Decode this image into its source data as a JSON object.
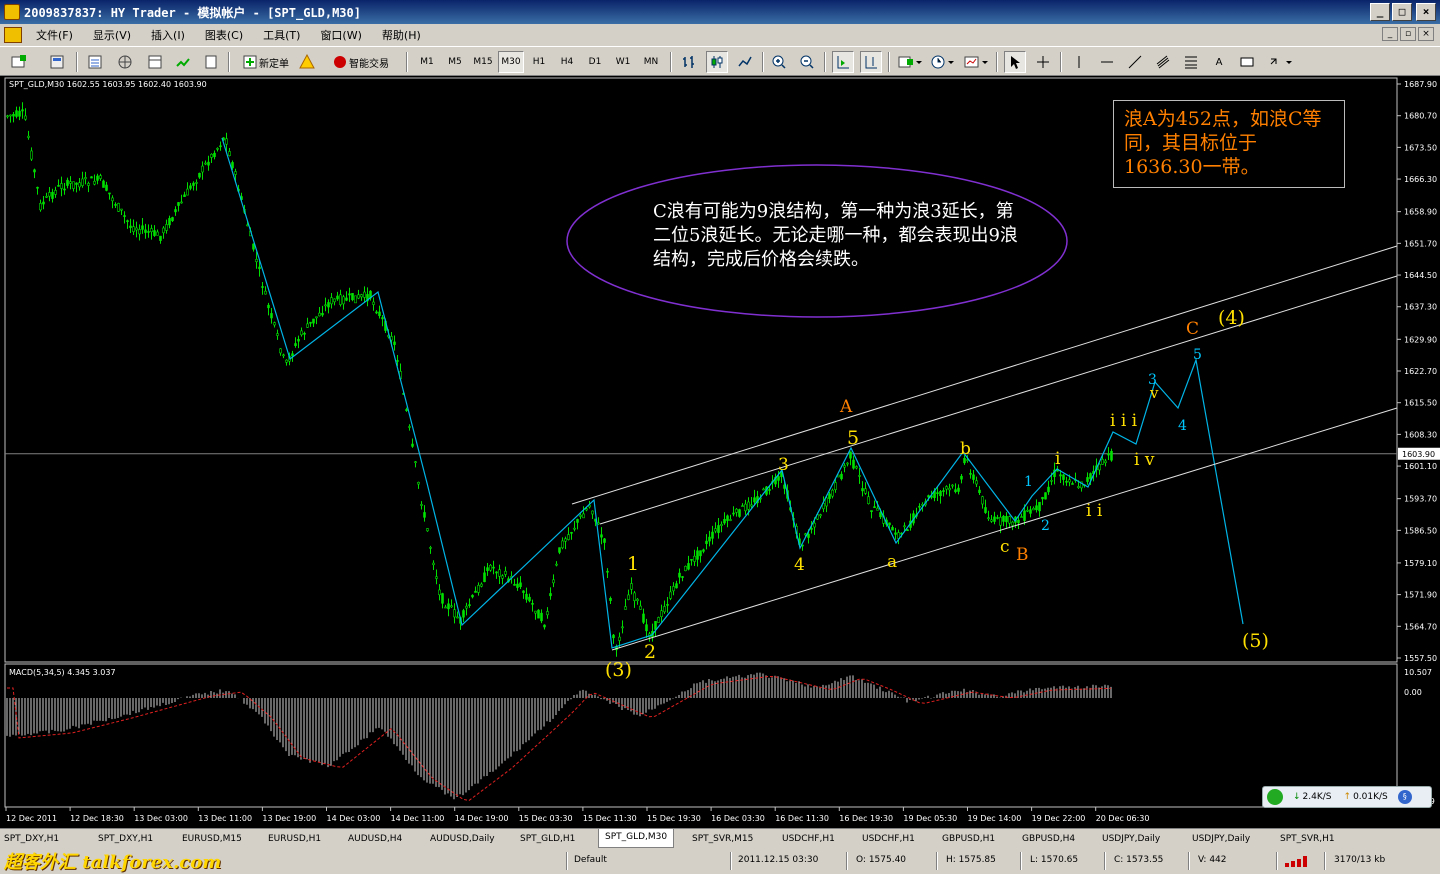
{
  "window": {
    "title": "2009837837: HY Trader - 模拟帐户 - [SPT_GLD,M30]",
    "min_glyph": "_",
    "max_glyph": "□",
    "close_glyph": "×"
  },
  "menu": [
    "文件(F)",
    "显示(V)",
    "插入(I)",
    "图表(C)",
    "工具(T)",
    "窗口(W)",
    "帮助(H)"
  ],
  "toolbar": {
    "new_order": "新定单",
    "expert": "智能交易",
    "timeframes": [
      "M1",
      "M5",
      "M15",
      "M30",
      "H1",
      "H4",
      "D1",
      "W1",
      "MN"
    ],
    "active_timeframe": "M30",
    "text_tool": "A"
  },
  "chart": {
    "symbol_info": "SPT_GLD,M30  1602.55 1603.95 1602.40 1603.90",
    "current_price": "1603.90",
    "price_ticks": [
      "1687.90",
      "1680.70",
      "1673.50",
      "1666.30",
      "1658.90",
      "1651.70",
      "1644.50",
      "1637.30",
      "1629.90",
      "1622.70",
      "1615.50",
      "1608.30",
      "1601.10",
      "1593.70",
      "1586.50",
      "1579.10",
      "1571.90",
      "1564.70",
      "1557.50"
    ],
    "time_ticks": [
      "12 Dec 2011",
      "12 Dec 18:30",
      "13 Dec 03:00",
      "13 Dec 11:00",
      "13 Dec 19:00",
      "14 Dec 03:00",
      "14 Dec 11:00",
      "14 Dec 19:00",
      "15 Dec 03:30",
      "15 Dec 11:30",
      "15 Dec 19:30",
      "16 Dec 03:30",
      "16 Dec 11:30",
      "16 Dec 19:30",
      "19 Dec 05:30",
      "19 Dec 14:00",
      "19 Dec 22:00",
      "20 Dec 06:30"
    ],
    "macd_info": "MACD(5,34,5) 4.345 3.037",
    "macd_ticks": [
      "10.507",
      "0.00",
      "-14.059"
    ],
    "colors": {
      "bull": "#00e000",
      "bear": "#00e000",
      "wave": "#00b4e6",
      "label_yellow": "#ffe000",
      "label_orange": "#ff8000",
      "label_cyan": "#00c8ff"
    }
  },
  "annotations": {
    "ellipse_text": "C浪有可能为9浪结构，第一种为浪3延长，第二位5浪延长。无论走哪一种，都会表现出9浪结构，完成后价格会续跌。",
    "box_text": "浪A为452点，如浪C等同，其目标位于1636.30一带。",
    "wave_labels": [
      {
        "id": "w3",
        "text": "(3)"
      },
      {
        "id": "w1",
        "text": "1"
      },
      {
        "id": "w2",
        "text": "2"
      },
      {
        "id": "w3s",
        "text": "3"
      },
      {
        "id": "w4s",
        "text": "4"
      },
      {
        "id": "w5s",
        "text": "5"
      },
      {
        "id": "wA",
        "text": "A"
      },
      {
        "id": "wa",
        "text": "a"
      },
      {
        "id": "wb",
        "text": "b"
      },
      {
        "id": "wc",
        "text": "c"
      },
      {
        "id": "wB",
        "text": "B"
      },
      {
        "id": "c1",
        "text": "1"
      },
      {
        "id": "c2",
        "text": "2"
      },
      {
        "id": "ci",
        "text": "i"
      },
      {
        "id": "cii",
        "text": "i i"
      },
      {
        "id": "ciii",
        "text": "i i i"
      },
      {
        "id": "civ",
        "text": "i v"
      },
      {
        "id": "cv",
        "text": "v"
      },
      {
        "id": "c3",
        "text": "3"
      },
      {
        "id": "c4",
        "text": "4"
      },
      {
        "id": "c5",
        "text": "5"
      },
      {
        "id": "wC",
        "text": "C"
      },
      {
        "id": "w4",
        "text": "(4)"
      },
      {
        "id": "w5",
        "text": "(5)"
      }
    ]
  },
  "netbadge": {
    "down": "2.4K/S",
    "up": "0.01K/S"
  },
  "tabs": [
    "SPT_DXY,H1",
    "SPT_DXY,H1",
    "EURUSD,M15",
    "EURUSD,H1",
    "AUDUSD,H4",
    "AUDUSD,Daily",
    "SPT_GLD,H1",
    "SPT_GLD,M30",
    "SPT_SVR,M15",
    "USDCHF,H1",
    "USDCHF,H1",
    "GBPUSD,H1",
    "GBPUSD,H4",
    "USDJPY,Daily",
    "USDJPY,Daily",
    "SPT_SVR,H1"
  ],
  "active_tab": "SPT_GLD,M30",
  "status": {
    "profile": "Default",
    "datetime": "2011.12.15 03:30",
    "open": "O: 1575.40",
    "high": "H: 1575.85",
    "low": "L: 1570.65",
    "close": "C: 1573.55",
    "volume": "V: 442",
    "traffic": "3170/13 kb",
    "watermark": "超客外汇 talkforex.com"
  }
}
